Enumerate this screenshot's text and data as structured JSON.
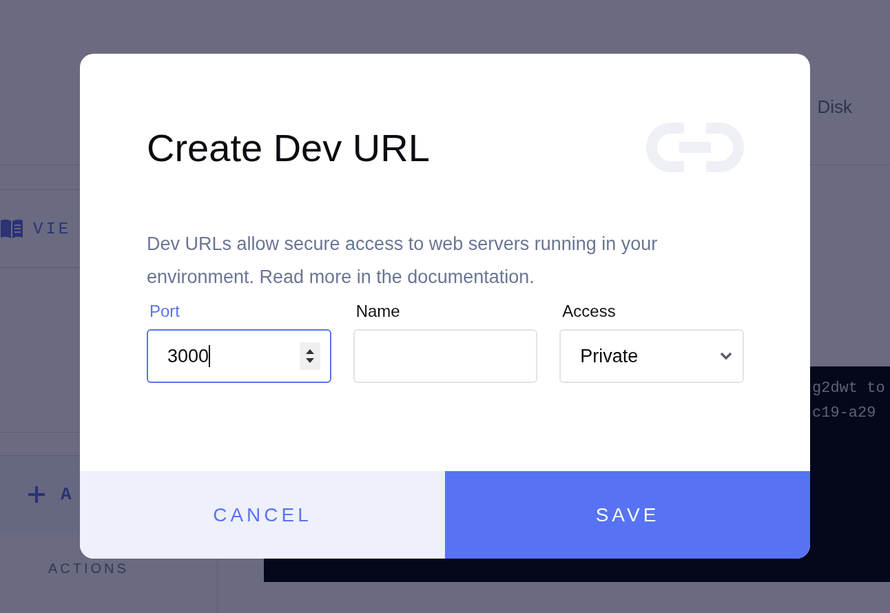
{
  "background": {
    "disk_label": "Disk",
    "view_button": "VIE",
    "add_button": "A",
    "actions_label": "ACTIONS",
    "terminal_lines": [
      "g2dwt to",
      "c19-a29"
    ]
  },
  "dialog": {
    "title": "Create Dev URL",
    "description": "Dev URLs allow secure access to web servers running in your environment. Read more in the documentation.",
    "fields": [
      {
        "kind": "number",
        "label": "Port",
        "value": "3000",
        "focused": true
      },
      {
        "kind": "text",
        "label": "Name",
        "focused": false
      },
      {
        "kind": "select",
        "label": "Access",
        "value": "Private",
        "focused": false
      }
    ],
    "buttons": [
      {
        "kind": "secondary",
        "label": "CANCEL"
      },
      {
        "kind": "primary",
        "label": "SAVE"
      }
    ]
  }
}
